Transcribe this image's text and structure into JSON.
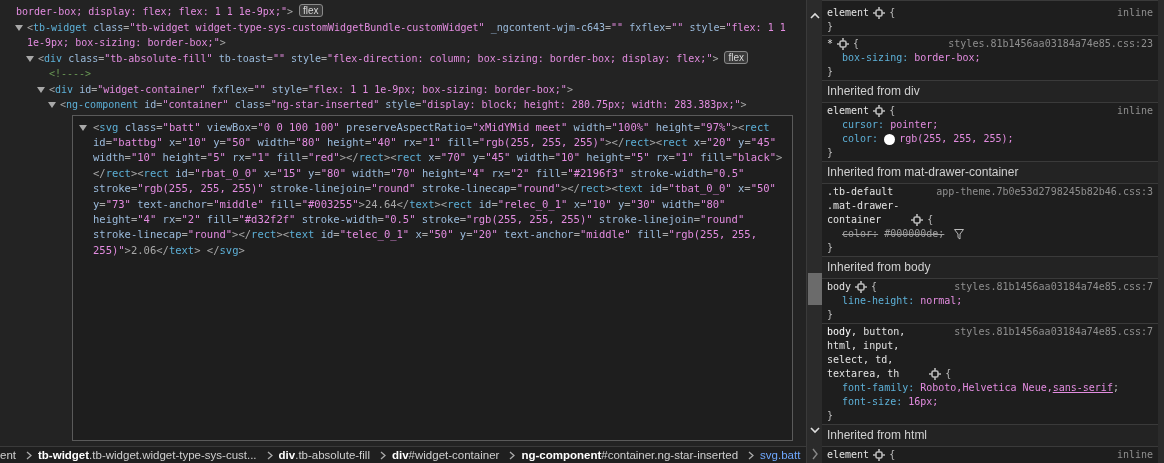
{
  "elements_panel": {
    "tree": [
      {
        "kind": "fragment",
        "markup": "border-box; display: flex; flex: 1 1 1e-9px;\">",
        "badge": "flex"
      },
      {
        "kind": "element",
        "markup": "<tb-widget class=\"tb-widget widget-type-sys-customWidgetBundle-customWidget\" _ngcontent-wjm-c643=\"\" fxflex=\"\" style=\"flex: 1 1 1e-9px; box-sizing: border-box;\">",
        "expanded": true,
        "editing": false,
        "children": [
          {
            "kind": "element",
            "markup": "<div class=\"tb-absolute-fill\" tb-toast=\"\" style=\"flex-direction: column; box-sizing: border-box; display: flex;\">",
            "badge": "flex",
            "expanded": true,
            "editing": false,
            "children": [
              {
                "kind": "comment",
                "markup": "<!---->"
              },
              {
                "kind": "element",
                "markup": "<div id=\"widget-container\" fxflex=\"\" style=\"flex: 1 1 1e-9px; box-sizing: border-box;\">",
                "expanded": true,
                "editing": false,
                "children": [
                  {
                    "kind": "element",
                    "markup": "<ng-component id=\"container\" class=\"ng-star-inserted\" style=\"display: block; height: 280.75px; width: 283.383px;\">",
                    "expanded": true,
                    "editing": false,
                    "children": [
                      {
                        "kind": "element",
                        "markup": "<svg class=\"batt\" viewBox=\"0 0 100 100\" preserveAspectRatio=\"xMidYMid meet\" width=\"100%\" height=\"97%\"><rect id=\"battbg\" x=\"10\" y=\"50\" width=\"80\" height=\"40\" rx=\"1\" fill=\"rgb(255, 255, 255)\"></rect><rect x=\"20\" y=\"45\" width=\"10\" height=\"5\" rx=\"1\" fill=\"red\"></rect><rect x=\"70\" y=\"45\" width=\"10\" height=\"5\" rx=\"1\" fill=\"black\"></rect><rect id=\"rbat_0_0\" x=\"15\" y=\"80\" width=\"70\" height=\"4\" rx=\"2\" fill=\"#2196f3\" stroke-width=\"0.5\" stroke=\"rgb(255, 255, 255)\" stroke-linejoin=\"round\" stroke-linecap=\"round\"></rect><text id=\"tbat_0_0\" x=\"50\" y=\"73\" text-anchor=\"middle\" fill=\"#003255\">24.64</text><rect id=\"relec_0_1\" x=\"10\" y=\"30\" width=\"80\" height=\"4\" rx=\"2\" fill=\"#d32f2f\" stroke-width=\"0.5\" stroke=\"rgb(255, 255, 255)\" stroke-linejoin=\"round\" stroke-linecap=\"round\"></rect><text id=\"telec_0_1\" x=\"50\" y=\"20\" text-anchor=\"middle\" fill=\"rgb(255, 255, 255)\">2.06</text> </svg>",
                        "expanded": true,
                        "editing": true
                      }
                    ]
                  }
                ]
              }
            ]
          }
        ]
      }
    ],
    "breadcrumbs": [
      {
        "label": "ent",
        "selected": false
      },
      {
        "label": "**tb-widget**.tb-widget.widget-type-sys-cust...",
        "selected": false
      },
      {
        "label": "**div**.tb-absolute-fill",
        "selected": false
      },
      {
        "label": "**div**#widget-container",
        "selected": false
      },
      {
        "label": "**ng-component**#container.ng-star-inserted",
        "selected": false
      },
      {
        "label": "svg.batt",
        "selected": true
      }
    ]
  },
  "styles_panel": {
    "sections": [
      {
        "kind": "rule",
        "selector": "element",
        "open": "{",
        "close": "}",
        "source": "inline"
      },
      {
        "kind": "rule",
        "selector": "*",
        "open": "{",
        "close": "}",
        "source": "styles.81b1456aa03184a74e85.css:23",
        "declarations": [
          {
            "property": "box-sizing:",
            "value": "border-box;",
            "struck": false
          }
        ]
      },
      {
        "kind": "header",
        "text": "Inherited from div"
      },
      {
        "kind": "rule",
        "selector": "element",
        "open": "{",
        "close": "}",
        "source": "inline",
        "declarations": [
          {
            "property": "cursor:",
            "value": "pointer;",
            "struck": false
          },
          {
            "property": "color:",
            "color": "#ffffff",
            "value": "rgb(255, 255, 255);",
            "struck": false
          }
        ]
      },
      {
        "kind": "header",
        "text": "Inherited from mat-drawer-container"
      },
      {
        "kind": "rule",
        "selector": ".tb-default .mat-drawer-container",
        "open": "{",
        "close": "}",
        "source": "app-theme.7b0e53d2798245b82b46.css:3",
        "declarations": [
          {
            "property": "color:",
            "value": "#000000de;",
            "struck": true
          }
        ]
      },
      {
        "kind": "header",
        "text": "Inherited from body"
      },
      {
        "kind": "rule",
        "selector": "body",
        "open": "{",
        "close": "}",
        "source": "styles.81b1456aa03184a74e85.css:7",
        "declarations": [
          {
            "property": "line-height:",
            "value": "normal;",
            "struck": false
          }
        ]
      },
      {
        "kind": "rule",
        "selector": "**body**, button, html, input, select, td, textarea, th",
        "open": "{",
        "close": "}",
        "source": "styles.81b1456aa03184a74e85.css:7",
        "declarations": [
          {
            "property": "font-family:",
            "value": "Roboto,Helvetica Neue,",
            "link": "sans-serif",
            "suffix": ";",
            "struck": false
          },
          {
            "property": "font-size:",
            "value": "16px;",
            "struck": false
          }
        ]
      },
      {
        "kind": "header",
        "text": "Inherited from html"
      },
      {
        "kind": "rule",
        "selector": "element",
        "open": "{",
        "source": "inline"
      }
    ]
  }
}
